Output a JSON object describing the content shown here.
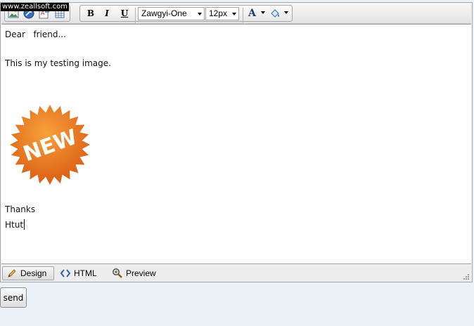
{
  "watermark": "www.zeallsoft.com",
  "toolbar": {
    "icons": [
      "insert-image-icon",
      "insert-link-icon",
      "special-char-icon",
      "insert-table-icon"
    ],
    "bold_label": "B",
    "italic_label": "I",
    "underline_label": "U",
    "font_family": "Zawgyi-One",
    "font_size": "12px",
    "font_color_label": "A",
    "accent_color": "#1b3a78",
    "highlight_color": "#2c6fb5"
  },
  "document": {
    "line1": "Dear   friend...",
    "line2": "This is my testing image.",
    "image_text": "NEW",
    "image_color": "#ea6a16",
    "line3": "Thanks",
    "line4": "Htut"
  },
  "tabs": [
    {
      "label": "Design",
      "icon": "pencil-icon",
      "active": true
    },
    {
      "label": "HTML",
      "icon": "code-brackets-icon",
      "active": false
    },
    {
      "label": "Preview",
      "icon": "magnifier-icon",
      "active": false
    }
  ],
  "send_label": "send"
}
